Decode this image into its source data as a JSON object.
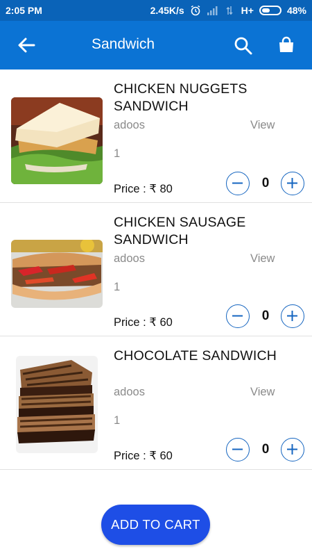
{
  "status_bar": {
    "time": "2:05 PM",
    "network_speed": "2.45K/s",
    "network_type": "H+",
    "battery": "48%",
    "battery_level": 0.48
  },
  "app_bar": {
    "title": "Sandwich",
    "back_icon": "arrow-left-icon",
    "search_icon": "search-icon",
    "bag_icon": "shopping-bag-icon",
    "color": "#0b73d4"
  },
  "products": [
    {
      "name_line1": "CHICKEN NUGGETS",
      "name_line2": "SANDWICH",
      "brand": "adoos",
      "view_label": "View",
      "quantity_text": "1",
      "price_label": "Price : ",
      "currency": "₹",
      "price": "80",
      "count": "0"
    },
    {
      "name_line1": "CHICKEN SAUSAGE",
      "name_line2": "SANDWICH",
      "brand": "adoos",
      "view_label": "View",
      "quantity_text": "1",
      "price_label": "Price : ",
      "currency": "₹",
      "price": "60",
      "count": "0"
    },
    {
      "name_line1": "CHOCOLATE SANDWICH",
      "name_line2": "",
      "brand": "adoos",
      "view_label": "View",
      "quantity_text": "1",
      "price_label": "Price : ",
      "currency": "₹",
      "price": "60",
      "count": "0"
    }
  ],
  "cart_button": {
    "label": "ADD TO CART",
    "color": "#1e4ee6"
  }
}
